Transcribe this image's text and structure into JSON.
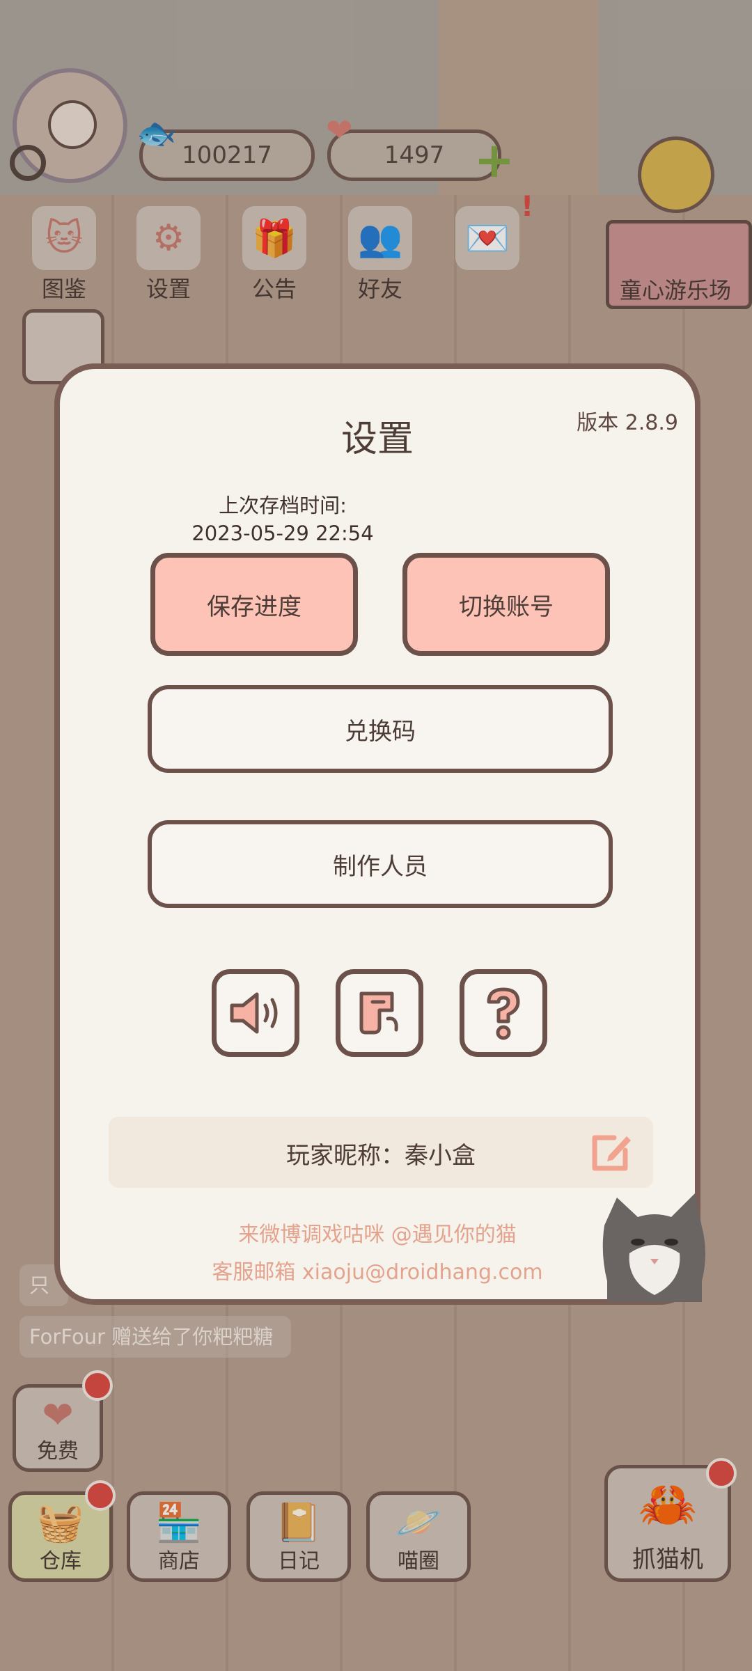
{
  "hud": {
    "coins": "100217",
    "hearts": "1497",
    "top_icons": [
      {
        "label": "图鉴",
        "icon": "cat-head-icon"
      },
      {
        "label": "设置",
        "icon": "gear-icon"
      },
      {
        "label": "公告",
        "icon": "gift-icon"
      },
      {
        "label": "好友",
        "icon": "friends-icon"
      },
      {
        "label": "",
        "icon": "heart-mail-icon"
      }
    ],
    "park_label": "童心游乐场"
  },
  "dialog": {
    "title": "设置",
    "version": "版本 2.8.9",
    "save_time_label": "上次存档时间:",
    "save_time_value": "2023-05-29 22:54",
    "save_button": "保存进度",
    "switch_account_button": "切换账号",
    "redeem_button": "兑换码",
    "credits_button": "制作人员",
    "icon_buttons": [
      "speaker-icon",
      "music-icon",
      "question-icon"
    ],
    "nickname": "玩家昵称：秦小盒",
    "weibo": "来微博调戏咕咪 @遇见你的猫",
    "email": "客服邮箱 xiaoju@droidhang.com"
  },
  "chat": {
    "line1": "只",
    "line2": "ForFour 赠送给了你粑粑糖"
  },
  "bottom": {
    "free": "免费",
    "warehouse": "仓库",
    "shop": "商店",
    "diary": "日记",
    "cat_circle": "喵圈",
    "claw_machine": "抓猫机"
  },
  "colors": {
    "pink_button": "#fdc3b6",
    "border_brown": "#6b5149",
    "accent_text": "#e3a38d",
    "dialog_bg": "#f6f2ec"
  }
}
